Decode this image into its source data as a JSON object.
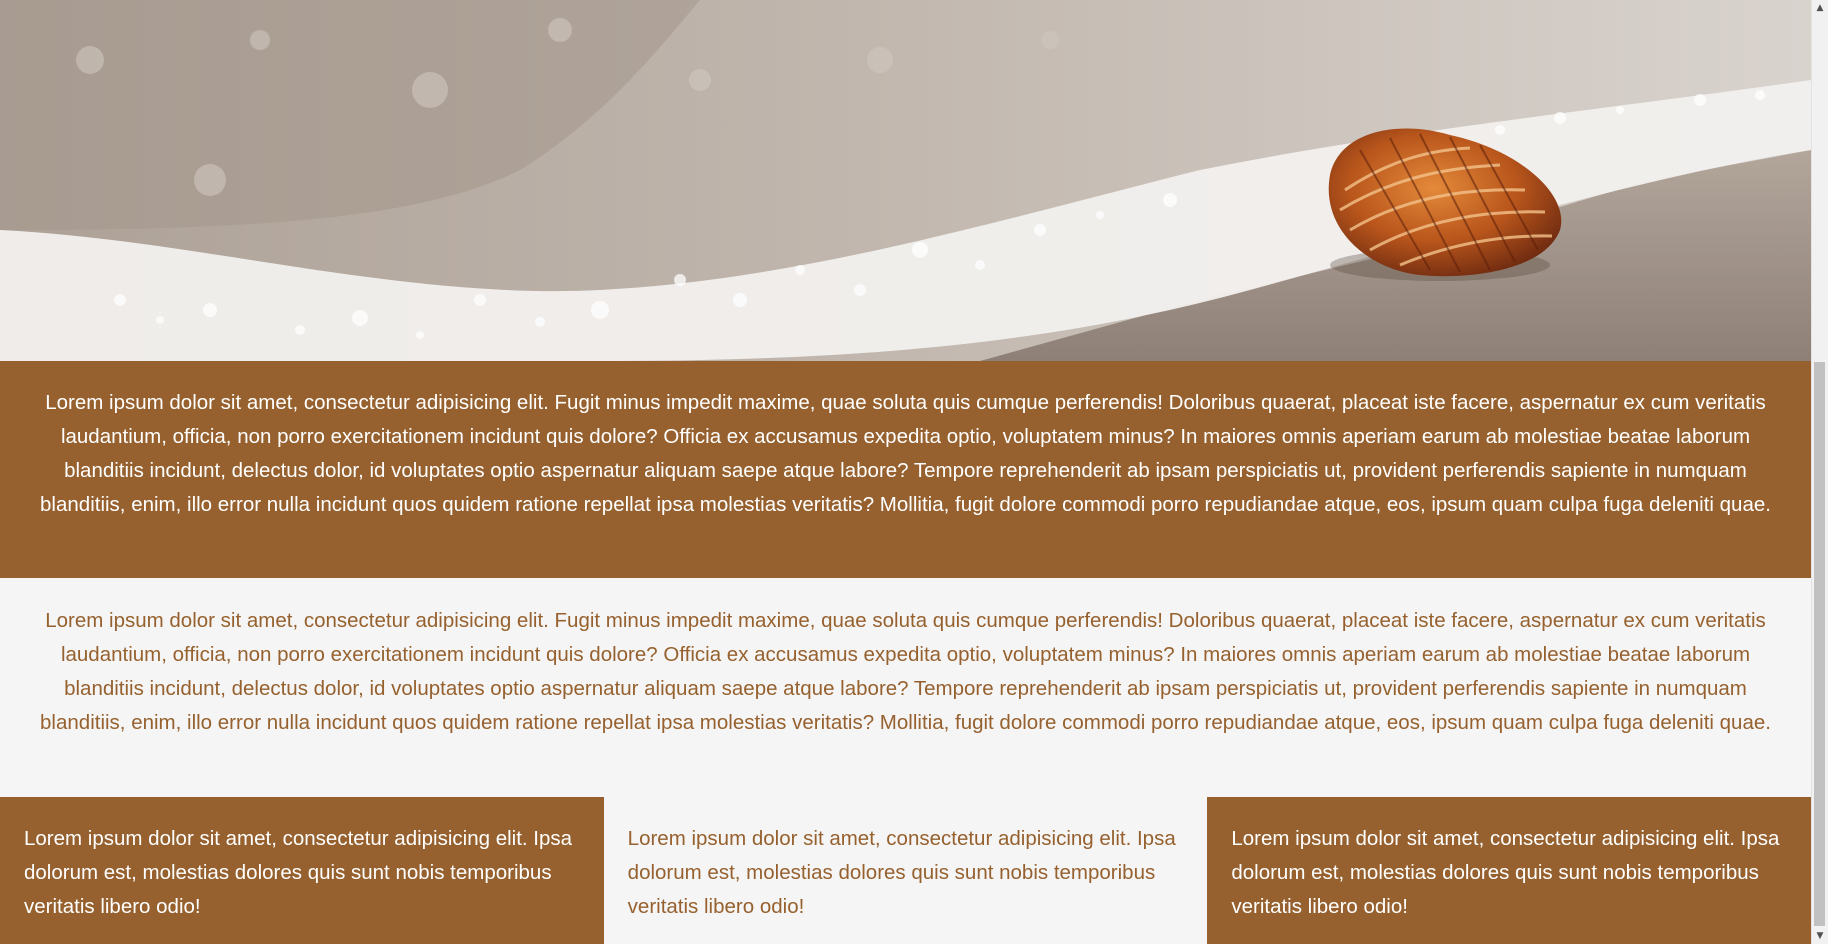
{
  "hero": {
    "image_name": "beach-shell-image"
  },
  "band_one": {
    "text": "Lorem ipsum dolor sit amet, consectetur adipisicing elit. Fugit minus impedit maxime, quae soluta quis cumque perferendis! Doloribus quaerat, placeat iste facere, aspernatur ex cum veritatis laudantium, officia, non porro exercitationem incidunt quis dolore? Officia ex accusamus expedita optio, voluptatem minus? In maiores omnis aperiam earum ab molestiae beatae laborum blanditiis incidunt, delectus dolor, id voluptates optio aspernatur aliquam saepe atque labore? Tempore reprehenderit ab ipsam perspiciatis ut, provident perferendis sapiente in numquam blanditiis, enim, illo error nulla incidunt quos quidem ratione repellat ipsa molestias veritatis? Mollitia, fugit dolore commodi porro repudiandae atque, eos, ipsum quam culpa fuga deleniti quae."
  },
  "band_two": {
    "text": "Lorem ipsum dolor sit amet, consectetur adipisicing elit. Fugit minus impedit maxime, quae soluta quis cumque perferendis! Doloribus quaerat, placeat iste facere, aspernatur ex cum veritatis laudantium, officia, non porro exercitationem incidunt quis dolore? Officia ex accusamus expedita optio, voluptatem minus? In maiores omnis aperiam earum ab molestiae beatae laborum blanditiis incidunt, delectus dolor, id voluptates optio aspernatur aliquam saepe atque labore? Tempore reprehenderit ab ipsam perspiciatis ut, provident perferendis sapiente in numquam blanditiis, enim, illo error nulla incidunt quos quidem ratione repellat ipsa molestias veritatis? Mollitia, fugit dolore commodi porro repudiandae atque, eos, ipsum quam culpa fuga deleniti quae."
  },
  "columns": [
    {
      "text": "Lorem ipsum dolor sit amet, consectetur adipisicing elit. Ipsa dolorum est, molestias dolores quis sunt nobis temporibus veritatis libero odio!"
    },
    {
      "text": "Lorem ipsum dolor sit amet, consectetur adipisicing elit. Ipsa dolorum est, molestias dolores quis sunt nobis temporibus veritatis libero odio!"
    },
    {
      "text": "Lorem ipsum dolor sit amet, consectetur adipisicing elit. Ipsa dolorum est, molestias dolores quis sunt nobis temporibus veritatis libero odio!"
    }
  ],
  "colors": {
    "brand_brown": "#96612e",
    "light_background": "#f5f5f5",
    "white_text": "#ffffff"
  },
  "scrollbar": {
    "up_icon": "chevron-up-icon",
    "down_icon": "chevron-down-icon"
  }
}
